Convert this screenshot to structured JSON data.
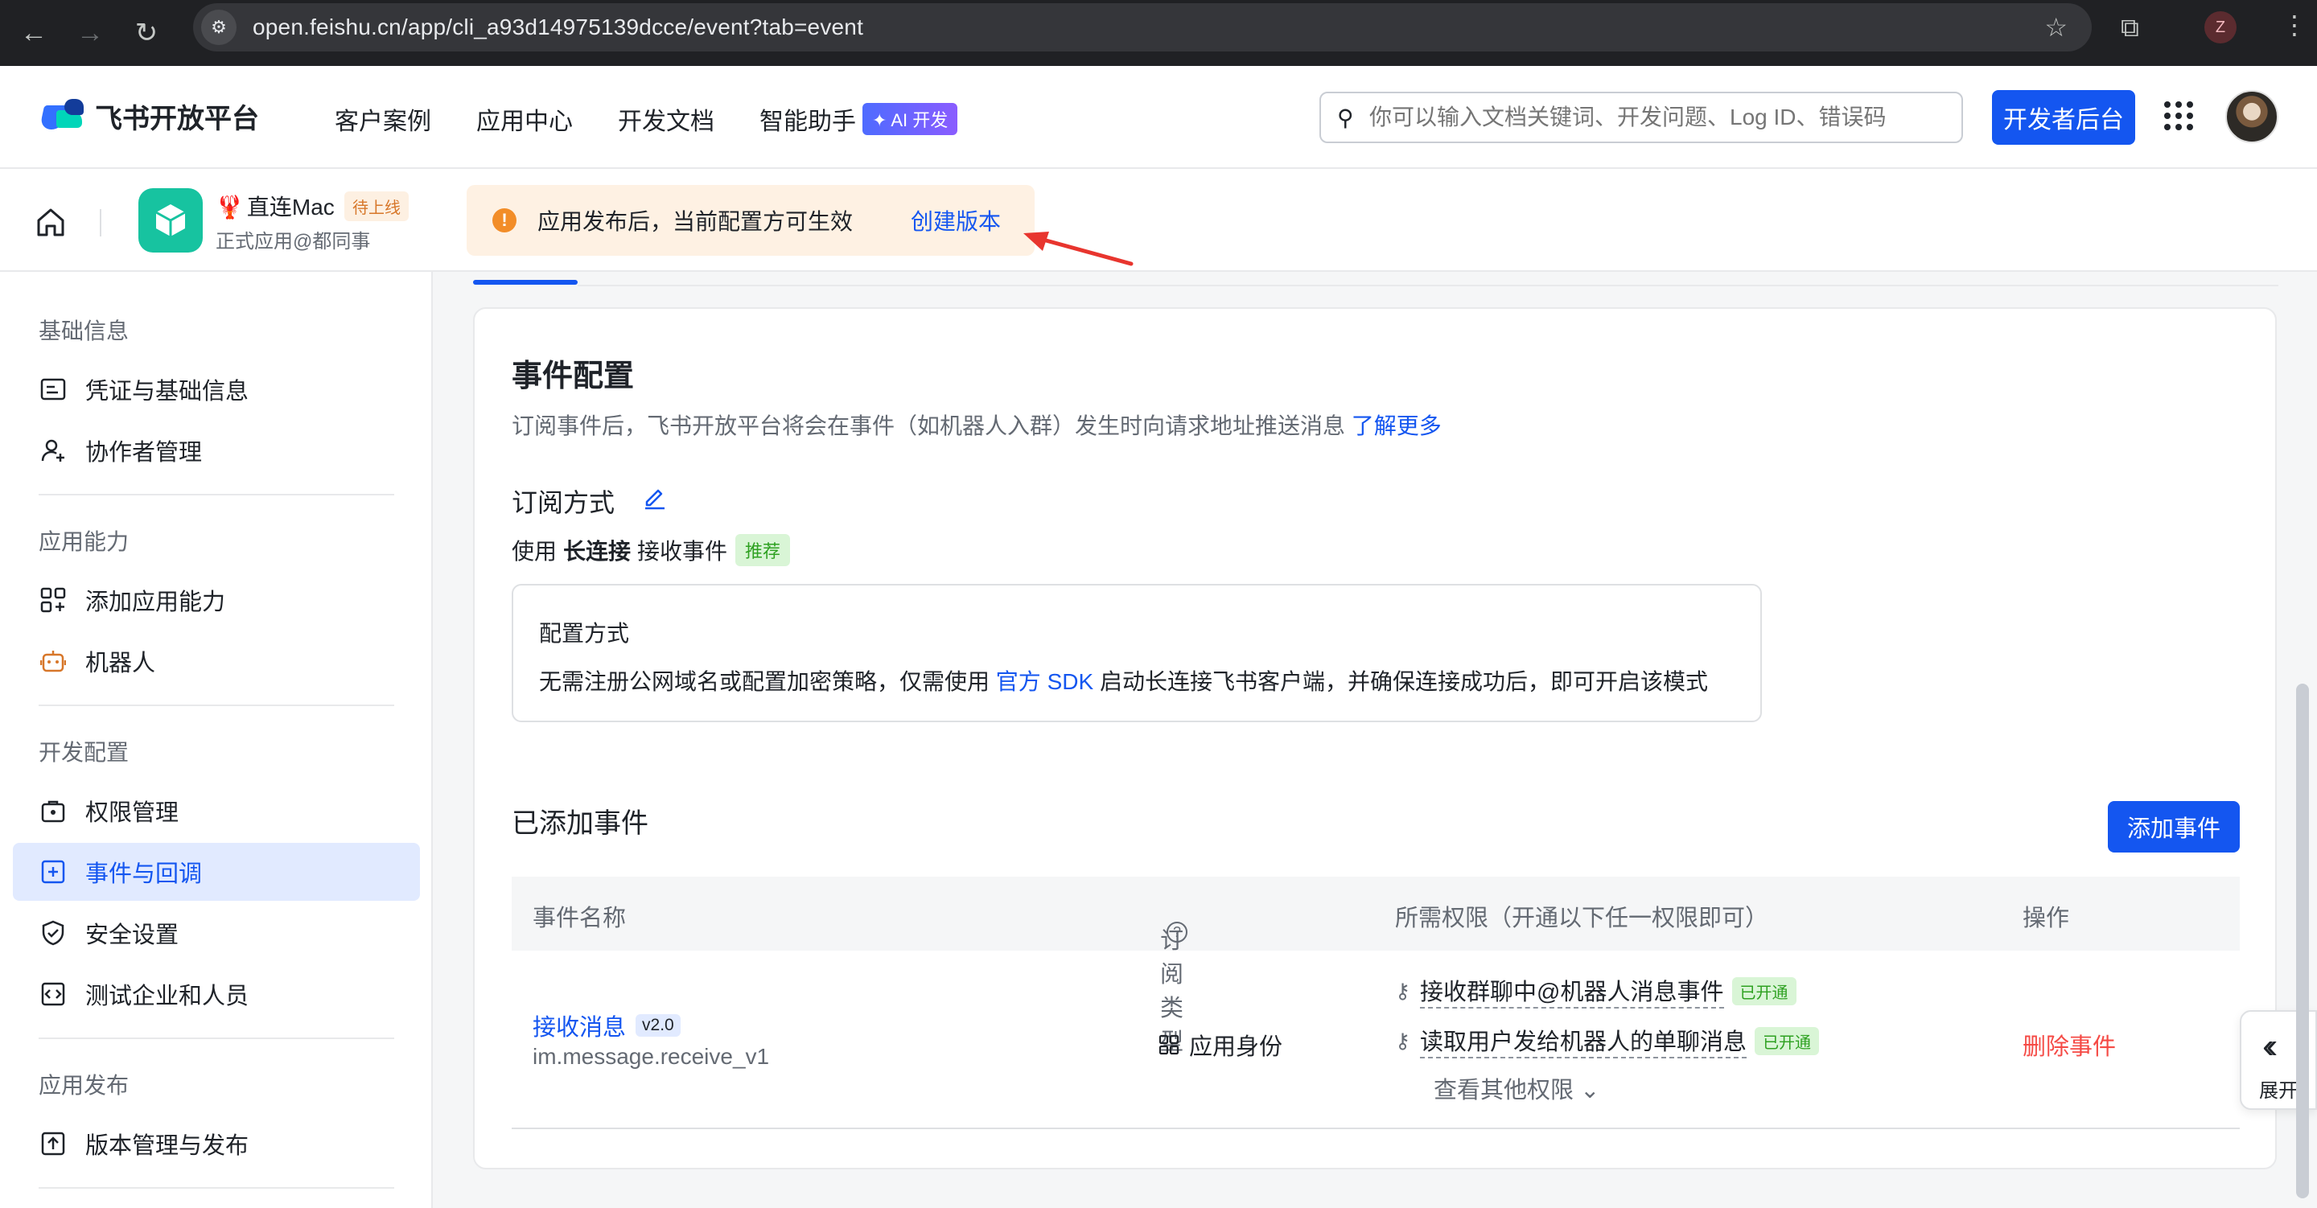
{
  "browser": {
    "url": "open.feishu.cn/app/cli_a93d14975139dcce/event?tab=event",
    "back_icon": "back-arrow-icon",
    "forward_icon": "forward-arrow-icon",
    "reload_icon": "reload-icon",
    "profile_letter": "Z"
  },
  "header": {
    "logo_text": "飞书开放平台",
    "nav": [
      "客户案例",
      "应用中心",
      "开发文档",
      "智能助手"
    ],
    "ai_badge": "✦ AI 开发",
    "search_placeholder": "你可以输入文档关键词、开发问题、Log ID、错误码",
    "dev_console": "开发者后台"
  },
  "app": {
    "name": "直连Mac",
    "status": "待上线",
    "subtitle": "正式应用@都同事",
    "notice": "应用发布后，当前配置方可生效",
    "notice_link": "创建版本"
  },
  "sidebar": {
    "sections": [
      {
        "title": "基础信息",
        "items": [
          "凭证与基础信息",
          "协作者管理"
        ]
      },
      {
        "title": "应用能力",
        "items": [
          "添加应用能力",
          "机器人"
        ]
      },
      {
        "title": "开发配置",
        "items": [
          "权限管理",
          "事件与回调",
          "安全设置",
          "测试企业和人员"
        ]
      },
      {
        "title": "应用发布",
        "items": [
          "版本管理与发布"
        ]
      }
    ],
    "active": "事件与回调"
  },
  "main": {
    "title": "事件配置",
    "desc": "订阅事件后，飞书开放平台将会在事件（如机器人入群）发生时向请求地址推送消息",
    "desc_link": "了解更多",
    "subscribe_title": "订阅方式",
    "mode_prefix": "使用",
    "mode_bold": "长连接",
    "mode_suffix": "接收事件",
    "mode_tag": "推荐",
    "config_title": "配置方式",
    "config_desc_a": "无需注册公网域名或配置加密策略，仅需使用",
    "config_link": "官方 SDK",
    "config_desc_b": "启动长连接飞书客户端，并确保连接成功后，即可开启该模式",
    "added_title": "已添加事件",
    "add_button": "添加事件",
    "columns": [
      "事件名称",
      "订阅类型",
      "所需权限（开通以下任一权限即可）",
      "操作"
    ],
    "rows": [
      {
        "name": "接收消息",
        "version": "v2.0",
        "code": "im.message.receive_v1",
        "sub_type": "应用身份",
        "perms": [
          {
            "text": "接收群聊中@机器人消息事件",
            "status": "已开通"
          },
          {
            "text": "读取用户发给机器人的单聊消息",
            "status": "已开通"
          }
        ],
        "view_more": "查看其他权限",
        "action": "删除事件"
      }
    ],
    "expand_label": "展开"
  },
  "colors": {
    "primary": "#1456f0",
    "danger": "#f54a45",
    "success": "#2ea121",
    "warning": "#f28d28"
  }
}
